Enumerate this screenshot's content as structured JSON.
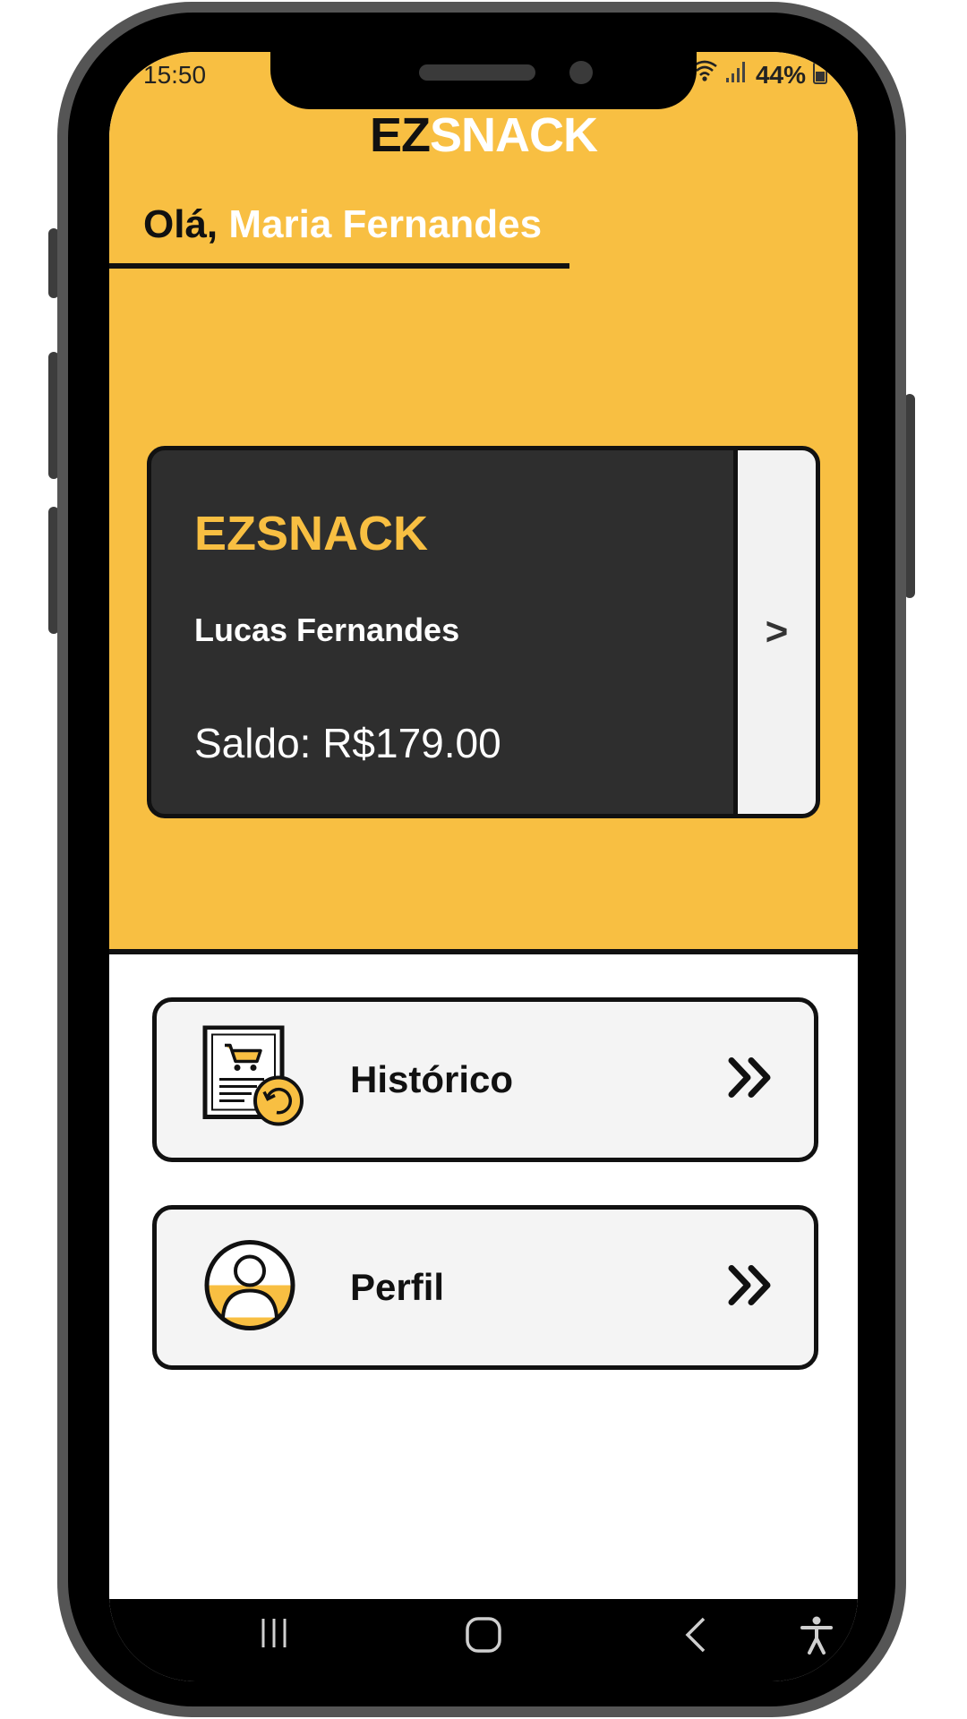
{
  "status_bar": {
    "time": "15:50",
    "battery": "44%"
  },
  "header": {
    "brand_part1": "EZ",
    "brand_part2": "SNACK"
  },
  "greeting": {
    "hello": "Olá,",
    "user_name": "Maria Fernandes"
  },
  "card": {
    "brand": "EZSNACK",
    "holder_name": "Lucas Fernandes",
    "balance": "Saldo: R$179.00",
    "arrow": ">"
  },
  "menu": {
    "items": [
      {
        "label": "Histórico",
        "icon": "history-receipt-icon"
      },
      {
        "label": "Perfil",
        "icon": "profile-user-icon"
      }
    ]
  },
  "colors": {
    "accent": "#f8bf42",
    "card_bg": "#2e2e2e",
    "text_dark": "#111111"
  },
  "nav_bar": {
    "icons": [
      "recent-apps-icon",
      "home-icon",
      "back-icon",
      "accessibility-icon"
    ]
  }
}
